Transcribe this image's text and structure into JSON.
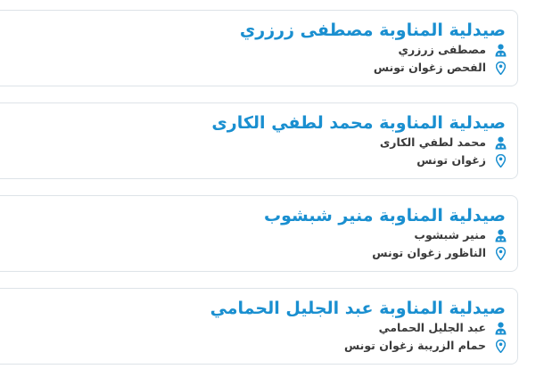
{
  "colors": {
    "accent": "#1a8fd0",
    "text": "#3a3a3a",
    "border": "#dde3e8"
  },
  "icons": {
    "person": "pharmacist-icon",
    "location": "location-pin-icon"
  },
  "pharmacies": [
    {
      "title": "صيدلية المناوبة مصطفى زرزري",
      "pharmacist": "مصطفى زرزري",
      "address": "الفحص زغوان تونس"
    },
    {
      "title": "صيدلية المناوبة محمد لطفي الكارى",
      "pharmacist": "محمد لطفي الكارى",
      "address": "زغوان تونس"
    },
    {
      "title": "صيدلية المناوبة منير شبشوب",
      "pharmacist": "منير شبشوب",
      "address": "الناظور زغوان تونس"
    },
    {
      "title": "صيدلية المناوبة عبد الجليل الحمامي",
      "pharmacist": "عبد الجليل الحمامي",
      "address": "حمام الزريبة زغوان تونس"
    }
  ]
}
